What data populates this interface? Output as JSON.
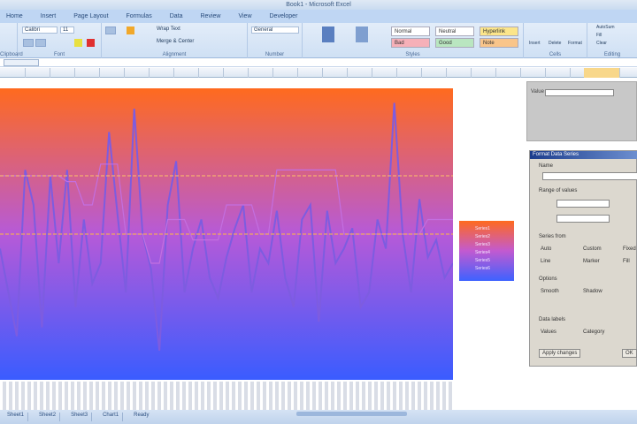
{
  "window": {
    "title": "Book1 - Microsoft Excel"
  },
  "tabs": [
    "Home",
    "Insert",
    "Page Layout",
    "Formulas",
    "Data",
    "Review",
    "View",
    "Developer"
  ],
  "ribbon": {
    "groups": [
      "Clipboard",
      "Font",
      "Alignment",
      "Number",
      "Styles",
      "Cells",
      "Editing"
    ],
    "font_name": "Calibri",
    "font_size": "11",
    "number_format": "General",
    "wrap_text": "Wrap Text",
    "merge": "Merge & Center",
    "styles": [
      {
        "label": "Normal",
        "bg": "#ffffff"
      },
      {
        "label": "Neutral",
        "bg": "#ffffff"
      },
      {
        "label": "Hyperlink",
        "bg": "#fce58a"
      },
      {
        "label": "Bad",
        "bg": "#f6b0b8"
      },
      {
        "label": "Good",
        "bg": "#b9e6c0"
      },
      {
        "label": "Note",
        "bg": "#f9c58a"
      }
    ],
    "cells_buttons": [
      "Insert",
      "Delete",
      "Format"
    ],
    "editing": [
      "AutoSum",
      "Fill",
      "Clear"
    ]
  },
  "chart_data": {
    "type": "line",
    "title": "",
    "xlabel": "",
    "ylabel": "",
    "ylim": [
      0,
      100
    ],
    "gradient": {
      "top": "#ff6a1e",
      "bottom": "#3a5cff"
    },
    "series": [
      {
        "name": "Series1",
        "color": "#7d5ce0",
        "values": [
          45,
          30,
          15,
          72,
          60,
          18,
          70,
          40,
          72,
          25,
          55,
          33,
          40,
          85,
          57,
          30,
          93,
          50,
          38,
          10,
          60,
          75,
          30,
          45,
          55,
          35,
          28,
          42,
          52,
          60,
          30,
          45,
          40,
          58,
          35,
          25,
          55,
          60,
          20,
          58,
          40,
          45,
          52,
          25,
          30,
          55,
          45,
          95,
          50,
          30,
          62,
          42,
          48,
          35,
          40
        ]
      },
      {
        "name": "Series2",
        "color": "#c36fe0",
        "values": [
          70,
          70,
          70,
          70,
          70,
          70,
          70,
          70,
          68,
          68,
          60,
          60,
          74,
          74,
          74,
          50,
          50,
          50,
          40,
          40,
          55,
          55,
          55,
          48,
          48,
          48,
          48,
          60,
          60,
          60,
          60,
          50,
          50,
          72,
          72,
          72,
          72,
          72,
          72,
          72,
          72,
          50,
          50,
          50,
          50,
          50,
          50,
          50,
          50,
          50,
          50,
          55,
          55,
          55,
          55
        ]
      },
      {
        "name": "Series3",
        "color": "#f0a860",
        "values": [
          50,
          50,
          50,
          50,
          50,
          50,
          50,
          50,
          50,
          50,
          50,
          50,
          50,
          50,
          50,
          50,
          50,
          50,
          50,
          50,
          50,
          50,
          50,
          50,
          50,
          50,
          50,
          50,
          50,
          50,
          50,
          50,
          50,
          50,
          50,
          50,
          50,
          50,
          50,
          50,
          50,
          50,
          50,
          50,
          50,
          50,
          50,
          50,
          50,
          50,
          50,
          50,
          50,
          50,
          50
        ]
      },
      {
        "name": "Series4",
        "color": "#f4b070",
        "values": [
          70,
          70,
          70,
          70,
          70,
          70,
          70,
          70,
          70,
          70,
          70,
          70,
          70,
          70,
          70,
          70,
          70,
          70,
          70,
          70,
          70,
          70,
          70,
          70,
          70,
          70,
          70,
          70,
          70,
          70,
          70,
          70,
          70,
          70,
          70,
          70,
          70,
          70,
          70,
          70,
          70,
          70,
          70,
          70,
          70,
          70,
          70,
          70,
          70,
          70,
          70,
          70,
          70,
          70,
          70
        ]
      },
      {
        "name": "Series5",
        "color": "#6a78f0",
        "values": []
      },
      {
        "name": "Series6",
        "color": "#5a8cf0",
        "values": []
      }
    ],
    "legend": "right"
  },
  "side_panel": {
    "label": "Value"
  },
  "dialog": {
    "title": "Format Data Series",
    "sections": [
      "Name",
      "Range of values",
      "Series from",
      "Options",
      "Data labels"
    ],
    "options": [
      "Auto",
      "Custom",
      "Fixed",
      "Line",
      "Marker",
      "Fill",
      "Smooth",
      "Shadow",
      "Values",
      "Category"
    ],
    "button_apply": "Apply changes",
    "button_ok": "OK"
  },
  "sheet_tabs": [
    "Sheet1",
    "Sheet2",
    "Sheet3",
    "Chart1"
  ],
  "status": {
    "ready": "Ready"
  }
}
